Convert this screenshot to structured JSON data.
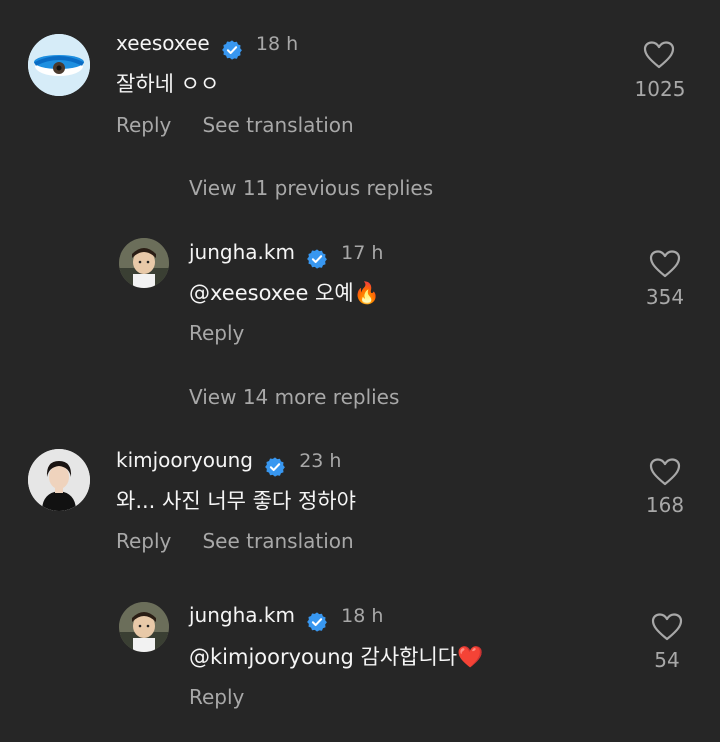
{
  "colors": {
    "background": "#262626",
    "verified_badge": "#3897f0",
    "secondary_text": "#a8a8a8",
    "primary_text": "#f5f5f5"
  },
  "comments": [
    {
      "username": "xeesoxee",
      "time": "18 h",
      "text": "잘하네 ㅇㅇ",
      "reply_label": "Reply",
      "translate_label": "See translation",
      "likes": "1025",
      "view_replies": "View 11 previous replies",
      "reply": {
        "username": "jungha.km",
        "time": "17 h",
        "text": "@xeesoxee 오예🔥",
        "reply_label": "Reply",
        "likes": "354"
      },
      "view_more": "View 14 more replies"
    },
    {
      "username": "kimjooryoung",
      "time": "23 h",
      "text": "와... 사진 너무 좋다 정하야",
      "reply_label": "Reply",
      "translate_label": "See translation",
      "likes": "168",
      "reply": {
        "username": "jungha.km",
        "time": "18 h",
        "text": "@kimjooryoung 감사합니다❤️",
        "reply_label": "Reply",
        "likes": "54"
      }
    }
  ],
  "icons": {
    "like": "heart-outline-icon",
    "verified": "verified-badge-icon"
  }
}
